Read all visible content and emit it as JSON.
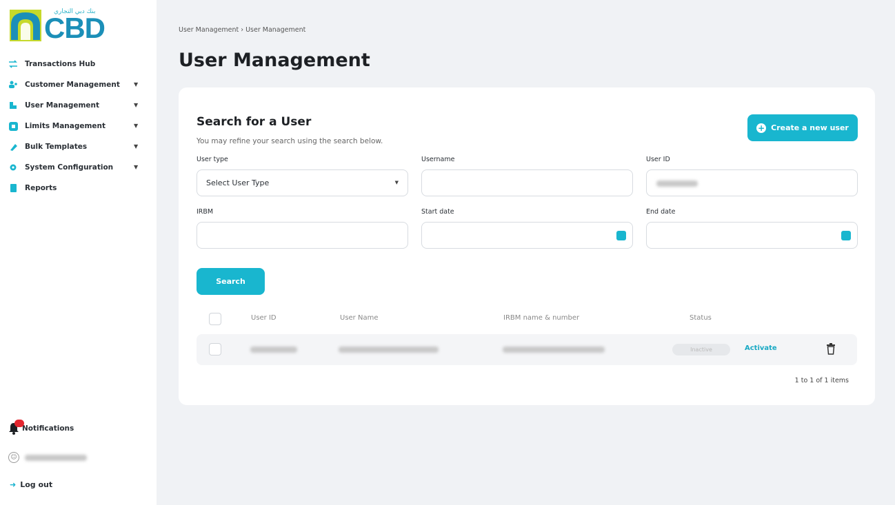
{
  "brand": {
    "logo_text": "CBD",
    "logo_arabic": "بنك دبي التجاري",
    "accent_color": "#19b6cf"
  },
  "sidebar": {
    "items": [
      {
        "label": "Transactions Hub",
        "icon": "transactions-icon",
        "expandable": false
      },
      {
        "label": "Customer Management",
        "icon": "customers-icon",
        "expandable": true
      },
      {
        "label": "User Management",
        "icon": "user-icon",
        "expandable": true
      },
      {
        "label": "Limits Management",
        "icon": "limits-icon",
        "expandable": true
      },
      {
        "label": "Bulk Templates",
        "icon": "templates-icon",
        "expandable": true
      },
      {
        "label": "System Configuration",
        "icon": "settings-icon",
        "expandable": true
      },
      {
        "label": "Reports",
        "icon": "reports-icon",
        "expandable": false
      }
    ],
    "notifications_label": "Notifications",
    "logout_label": "Log out"
  },
  "breadcrumb": "User Management  ›  User Management",
  "page_title": "User Management",
  "search_card": {
    "title": "Search for a User",
    "subtitle": "You may refine your search using the search below.",
    "create_button": "Create a new user",
    "fields": {
      "user_type_label": "User type",
      "user_type_value": "Select User Type",
      "username_label": "Username",
      "user_id_label": "User ID",
      "rm_label": "IRBM",
      "start_date_label": "Start date",
      "end_date_label": "End date"
    },
    "search_button": "Search"
  },
  "table": {
    "headers": [
      "User ID",
      "User Name",
      "IRBM name & number",
      "Status"
    ],
    "rows": [
      {
        "status": "Inactive",
        "action": "Activate"
      }
    ],
    "pagination": "1 to 1 of 1 items"
  }
}
